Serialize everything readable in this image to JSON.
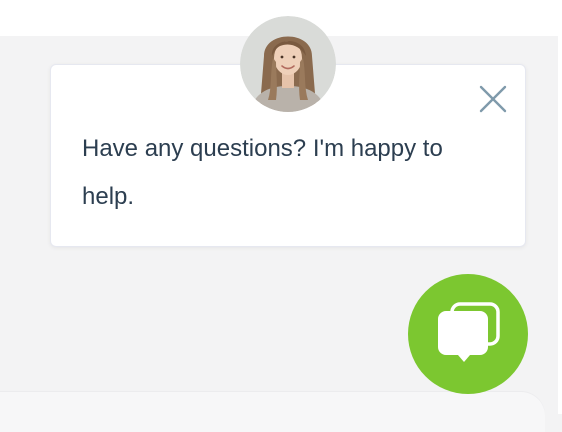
{
  "popup": {
    "message": "Have any questions? I'm happy to help.",
    "close_icon": "close-icon"
  },
  "avatar": {
    "icon": "agent-avatar"
  },
  "launcher": {
    "icon": "chat-bubbles-icon"
  },
  "colors": {
    "page_background": "#f3f3f4",
    "popup_background": "#ffffff",
    "message_text": "#2c3e50",
    "close_icon": "#7f9aab",
    "launcher_green": "#7cc730",
    "launcher_icon": "#ffffff"
  }
}
